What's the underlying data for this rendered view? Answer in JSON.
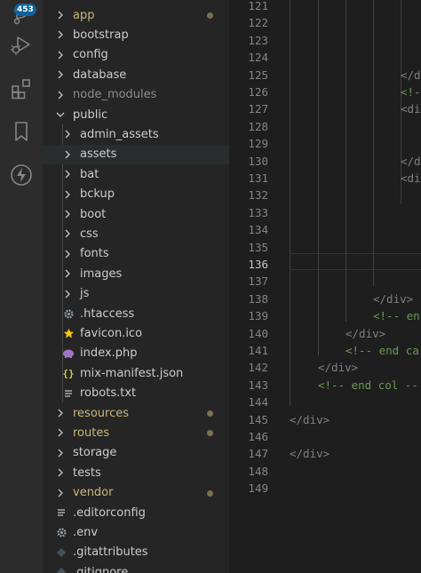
{
  "activity_bar": {
    "badge": "453",
    "icons": [
      "source-control-icon",
      "run-debug-icon",
      "extensions-icon",
      "bookmark-icon",
      "lightning-icon"
    ]
  },
  "explorer": {
    "items": [
      {
        "label": "app",
        "type": "folder",
        "modified": true
      },
      {
        "label": "bootstrap",
        "type": "folder"
      },
      {
        "label": "config",
        "type": "folder"
      },
      {
        "label": "database",
        "type": "folder"
      },
      {
        "label": "node_modules",
        "type": "folder",
        "dimmed": true
      },
      {
        "label": "public",
        "type": "folder",
        "expanded": true
      },
      {
        "label": "admin_assets",
        "type": "folder",
        "indent": 1
      },
      {
        "label": "assets",
        "type": "folder",
        "indent": 1,
        "selected": true
      },
      {
        "label": "bat",
        "type": "folder",
        "indent": 1
      },
      {
        "label": "bckup",
        "type": "folder",
        "indent": 1
      },
      {
        "label": "boot",
        "type": "folder",
        "indent": 1
      },
      {
        "label": "css",
        "type": "folder",
        "indent": 1
      },
      {
        "label": "fonts",
        "type": "folder",
        "indent": 1
      },
      {
        "label": "images",
        "type": "folder",
        "indent": 1
      },
      {
        "label": "js",
        "type": "folder",
        "indent": 1
      },
      {
        "label": ".htaccess",
        "type": "file",
        "icon": "gear-icon",
        "indent": 1
      },
      {
        "label": "favicon.ico",
        "type": "file",
        "icon": "star-icon",
        "indent": 1
      },
      {
        "label": "index.php",
        "type": "file",
        "icon": "php-elephant-icon",
        "indent": 1
      },
      {
        "label": "mix-manifest.json",
        "type": "file",
        "icon": "json-braces-icon",
        "indent": 1
      },
      {
        "label": "robots.txt",
        "type": "file",
        "icon": "text-lines-icon",
        "indent": 1
      },
      {
        "label": "resources",
        "type": "folder",
        "modified": true
      },
      {
        "label": "routes",
        "type": "folder",
        "modified": true
      },
      {
        "label": "storage",
        "type": "folder"
      },
      {
        "label": "tests",
        "type": "folder"
      },
      {
        "label": "vendor",
        "type": "folder",
        "modified": true
      },
      {
        "label": ".editorconfig",
        "type": "file",
        "icon": "text-lines-icon"
      },
      {
        "label": ".env",
        "type": "file",
        "icon": "gear-icon"
      },
      {
        "label": ".gitattributes",
        "type": "file",
        "icon": "git-icon"
      },
      {
        "label": ".gitignore",
        "type": "file",
        "icon": "git-icon"
      }
    ]
  },
  "editor": {
    "active_line": "136",
    "lines": [
      {
        "n": "121",
        "text": ""
      },
      {
        "n": "122",
        "text": ""
      },
      {
        "n": "123",
        "text": ""
      },
      {
        "n": "124",
        "text": ""
      },
      {
        "n": "125",
        "text": "</d"
      },
      {
        "n": "126",
        "text": "<!-"
      },
      {
        "n": "127",
        "text": "<di"
      },
      {
        "n": "128",
        "text": ""
      },
      {
        "n": "129",
        "text": ""
      },
      {
        "n": "130",
        "text": "</d"
      },
      {
        "n": "131",
        "text": "<di"
      },
      {
        "n": "132",
        "text": ""
      },
      {
        "n": "133",
        "text": ""
      },
      {
        "n": "134",
        "text": ""
      },
      {
        "n": "135",
        "text": ""
      },
      {
        "n": "136",
        "text": ""
      },
      {
        "n": "137",
        "text": ""
      },
      {
        "n": "138",
        "text": "</div>"
      },
      {
        "n": "139",
        "text": "<!-- en"
      },
      {
        "n": "140",
        "text": "</div>"
      },
      {
        "n": "141",
        "text": "<!-- end ca"
      },
      {
        "n": "142",
        "text": "</div>"
      },
      {
        "n": "143",
        "text": "<!-- end col --"
      },
      {
        "n": "144",
        "text": ""
      },
      {
        "n": "145",
        "text": "</div>"
      },
      {
        "n": "146",
        "text": ""
      },
      {
        "n": "147",
        "text": "</div>"
      },
      {
        "n": "148",
        "text": ""
      },
      {
        "n": "149",
        "text": ""
      }
    ]
  },
  "colors": {
    "tag": "#808080",
    "comment": "#6a9955",
    "folder_modified": "#c9b77a",
    "badge": "#0e639c"
  }
}
